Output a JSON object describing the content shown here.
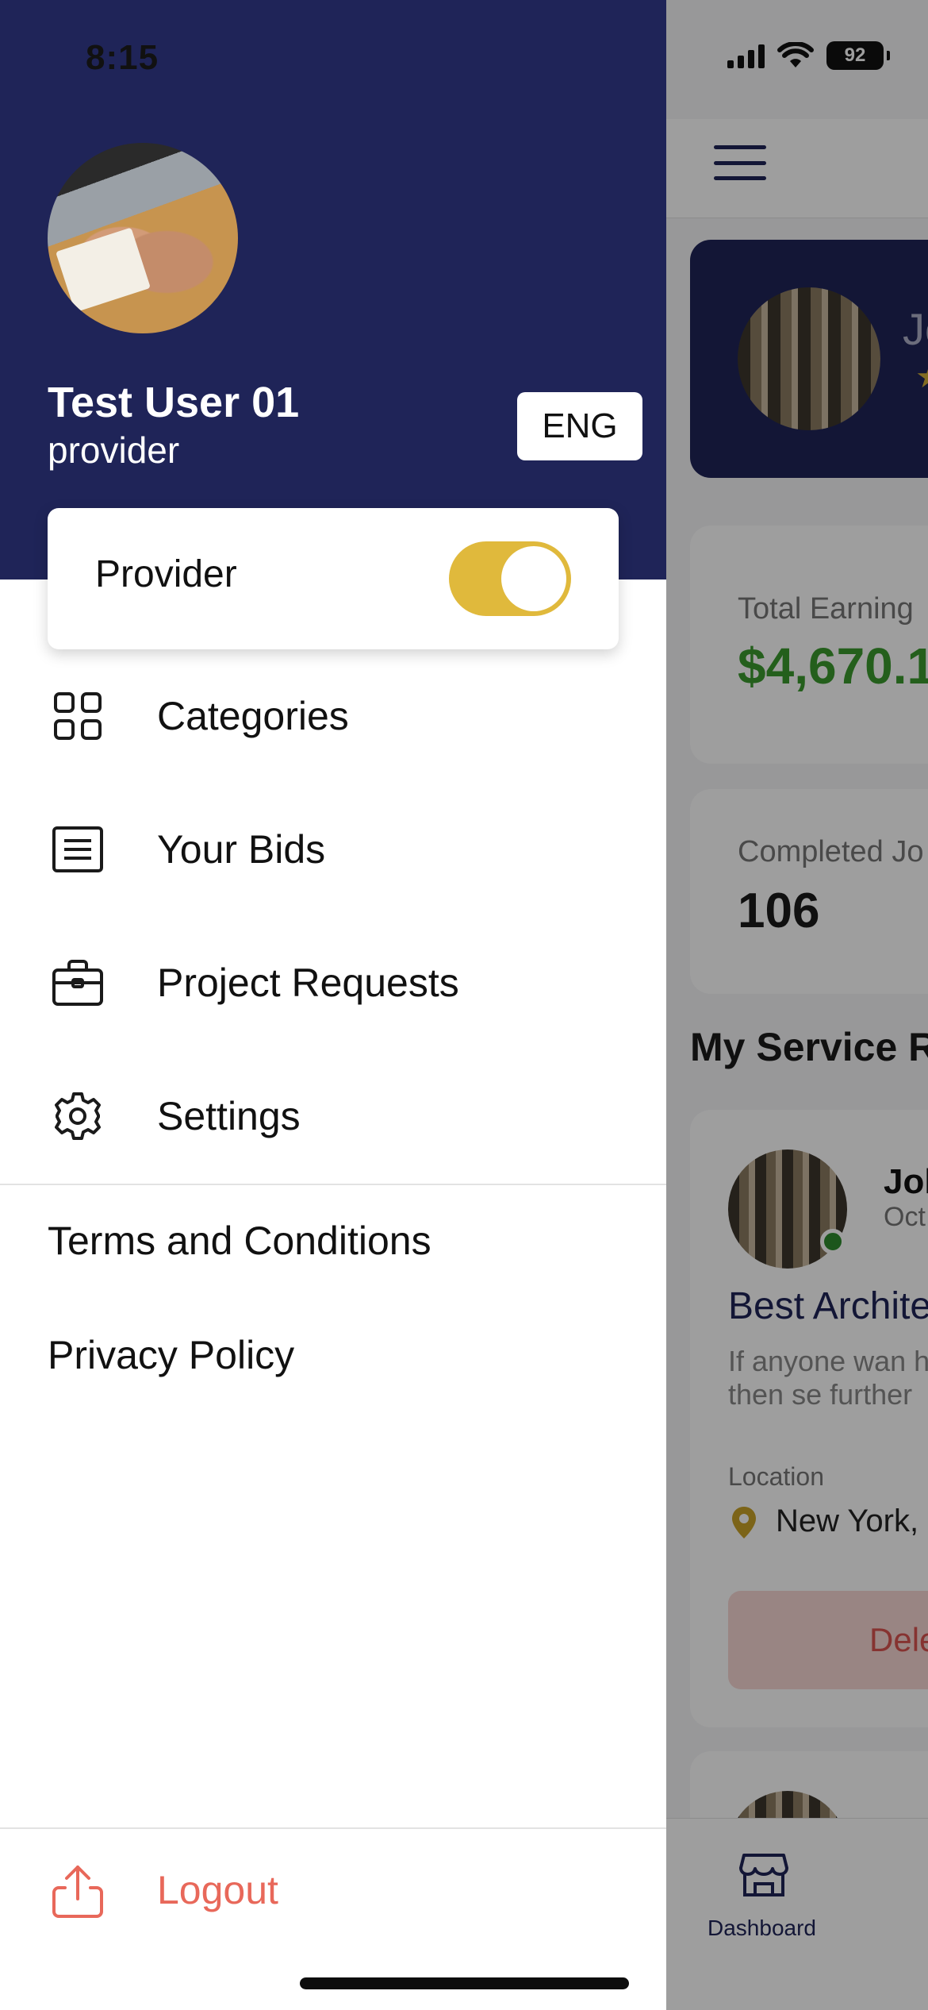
{
  "status_bar": {
    "time": "8:15",
    "battery": "92"
  },
  "drawer": {
    "user": {
      "name": "Test User 01",
      "role": "provider"
    },
    "language_button": "ENG",
    "provider_toggle": {
      "label": "Provider",
      "on": true
    },
    "menu": [
      {
        "label": "Categories",
        "icon": "grid-icon"
      },
      {
        "label": "Your Bids",
        "icon": "list-icon"
      },
      {
        "label": "Project Requests",
        "icon": "briefcase-icon"
      },
      {
        "label": "Settings",
        "icon": "gear-icon"
      }
    ],
    "links": {
      "terms": "Terms and Conditions",
      "privacy": "Privacy Policy"
    },
    "logout": "Logout"
  },
  "background": {
    "profile_name": "Jo",
    "total_earnings_label": "Total Earning",
    "total_earnings_value": "$4,670.1",
    "completed_jobs_label": "Completed Jo",
    "completed_jobs_value": "106",
    "section_title": "My Service R",
    "request": {
      "name": "Jol",
      "date": "Oct",
      "title": "Best Archite",
      "description": "If anyone wan house then se further",
      "location_label": "Location",
      "location_value": "New York,",
      "delete_button": "Dele"
    },
    "tab_bar": {
      "dashboard_label": "Dashboard"
    }
  },
  "colors": {
    "navy": "#1f2458",
    "gold": "#e0b93c",
    "green": "#3a9a2e",
    "logout_red": "#e8685a"
  }
}
